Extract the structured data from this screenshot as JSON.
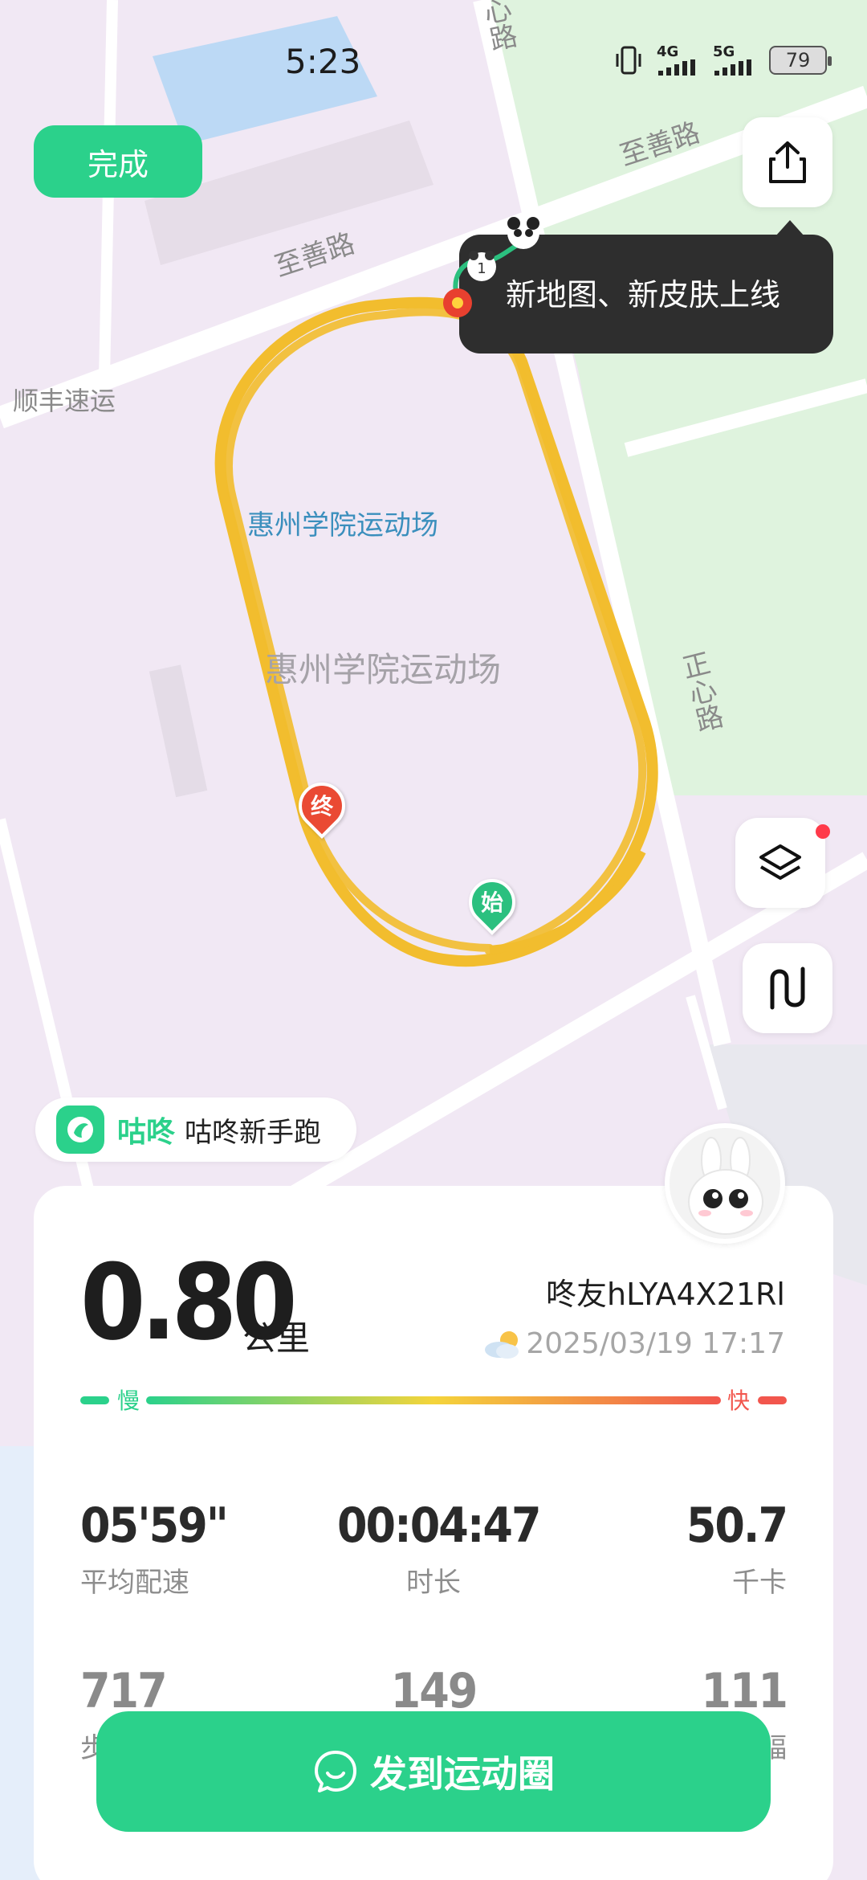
{
  "status_bar": {
    "time": "5:23",
    "network_1": "4G",
    "network_2": "5G",
    "battery": "79"
  },
  "header": {
    "done_label": "完成",
    "tooltip_text": "新地图、新皮肤上线"
  },
  "map": {
    "road_labels": [
      "至善路",
      "至善路",
      "心路",
      "正心路",
      "顺丰速运"
    ],
    "venue_label_blue": "惠州学院运动场",
    "venue_label_gray": "惠州学院运动场",
    "start_marker": "始",
    "end_marker": "终",
    "route_color": "#f2bd2e"
  },
  "app_badge": {
    "name": "咕咚",
    "subtitle": "咕咚新手跑"
  },
  "summary": {
    "distance": "0.80",
    "distance_unit": "公里",
    "nickname": "咚友hLYA4X21Rl",
    "datetime": "2025/03/19 17:17",
    "pace_slow": "慢",
    "pace_fast": "快",
    "stats": [
      {
        "value": "05'59\"",
        "label": "平均配速"
      },
      {
        "value": "00:04:47",
        "label": "时长"
      },
      {
        "value": "50.7",
        "label": "千卡"
      },
      {
        "value": "717",
        "label": "步"
      },
      {
        "value": "149",
        "label": ""
      },
      {
        "value": "111",
        "label": "幅"
      }
    ]
  },
  "actions": {
    "post_label": "发到运动圈"
  },
  "colors": {
    "brand_green": "#2bd18b",
    "fast_red": "#f2564d",
    "tooltip_bg": "#2e2e2e"
  }
}
